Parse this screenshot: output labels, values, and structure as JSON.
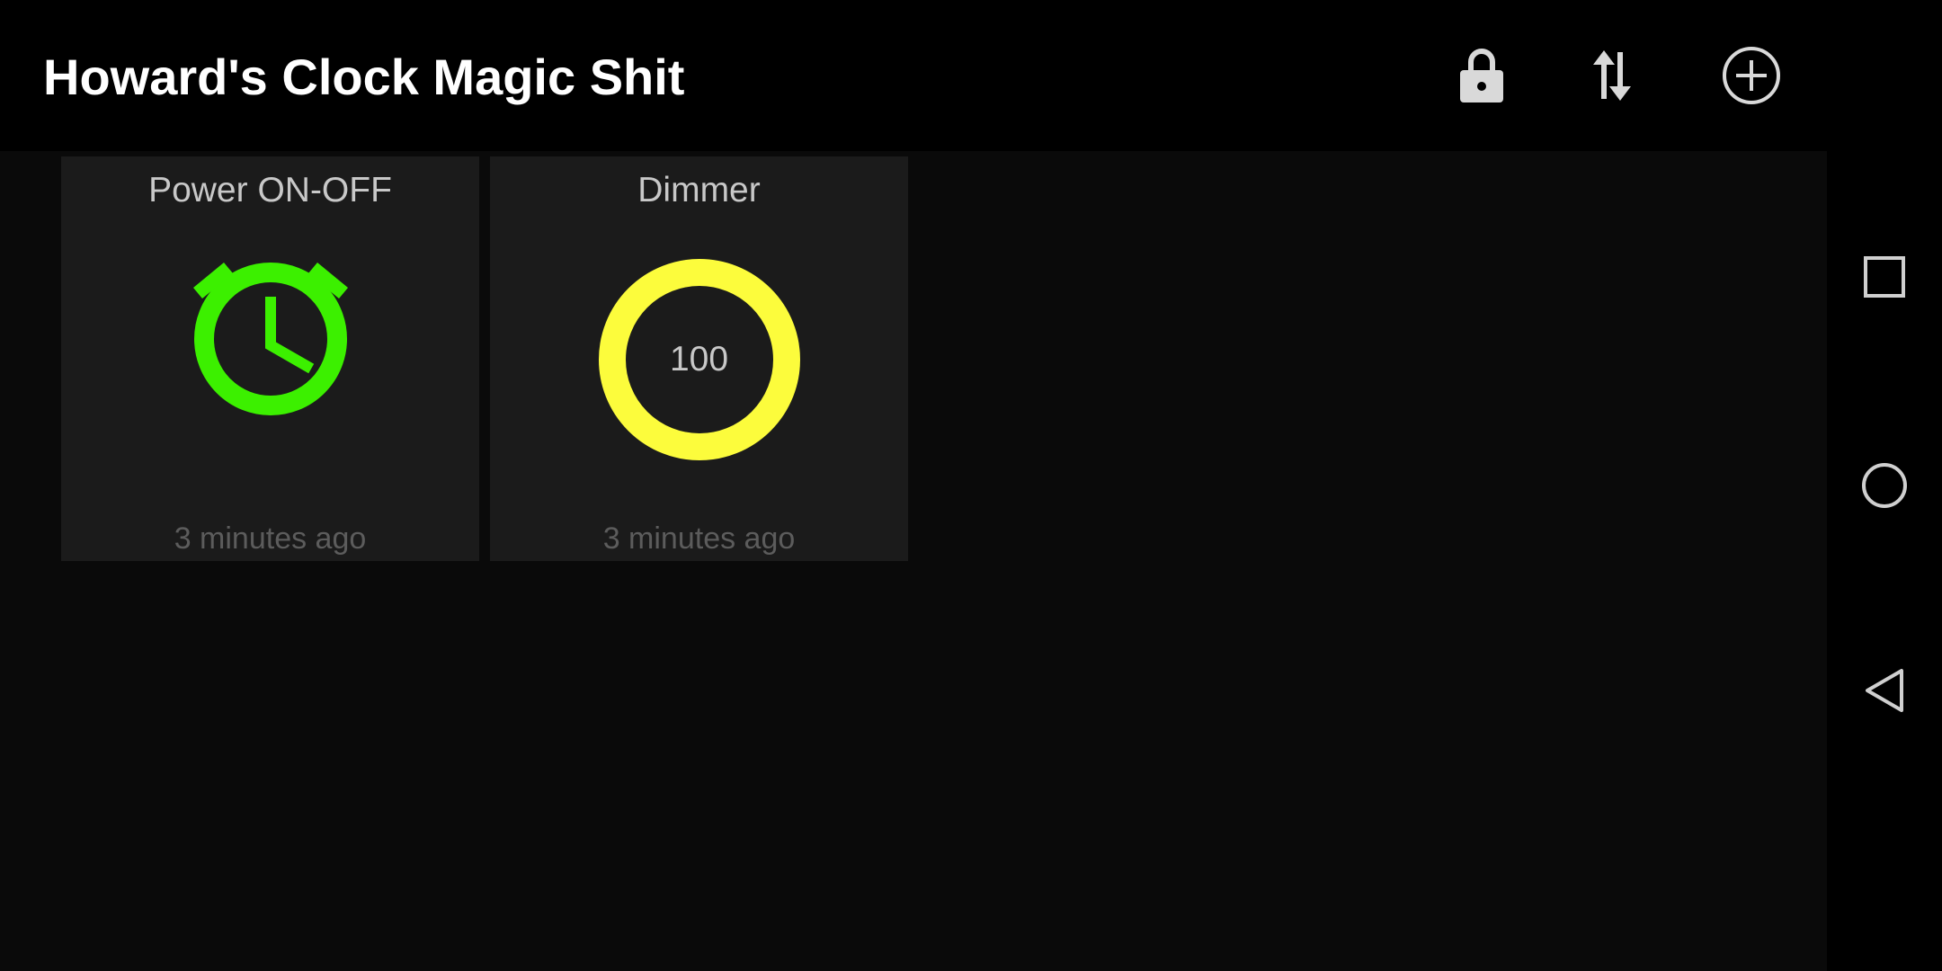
{
  "app_bar": {
    "title": "Howard's Clock Magic Shit",
    "actions": [
      {
        "name": "lock",
        "icon": "lock-icon"
      },
      {
        "name": "sort",
        "icon": "swap-vertical-icon"
      },
      {
        "name": "add",
        "icon": "add-circle-icon"
      }
    ]
  },
  "tiles": [
    {
      "title": "Power ON-OFF",
      "icon": "alarm-clock-icon",
      "icon_color": "#3cf000",
      "timestamp": "3 minutes ago"
    },
    {
      "title": "Dimmer",
      "value": "100",
      "ring_color": "#fcfc3c",
      "timestamp": "3 minutes ago"
    }
  ],
  "nav_bar": {
    "buttons": [
      {
        "name": "recents",
        "icon": "square-icon"
      },
      {
        "name": "home",
        "icon": "circle-icon"
      },
      {
        "name": "back",
        "icon": "triangle-back-icon"
      }
    ]
  }
}
